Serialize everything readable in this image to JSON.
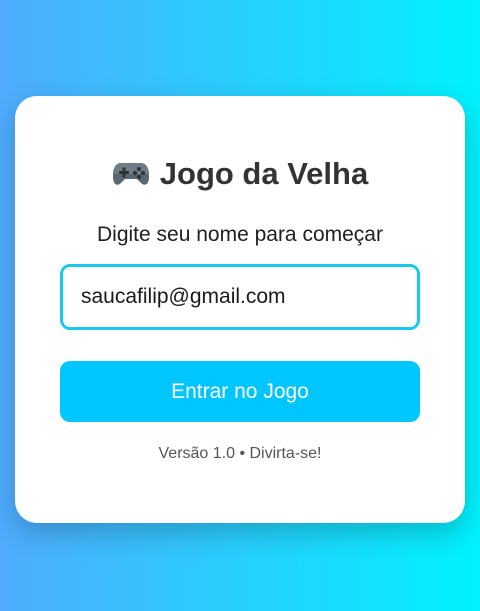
{
  "login": {
    "title": "Jogo da Velha",
    "title_icon": "gamepad-icon",
    "subtitle": "Digite seu nome para começar",
    "name_input_value": "saucafilip@gmail.com",
    "button_label": "Entrar no Jogo",
    "footer": "Versão 1.0 • Divirta-se!"
  },
  "colors": {
    "background_gradient_start": "#4facfe",
    "background_gradient_end": "#00f2fe",
    "button": "#00c6ff",
    "input_border": "#1cc8ef"
  }
}
